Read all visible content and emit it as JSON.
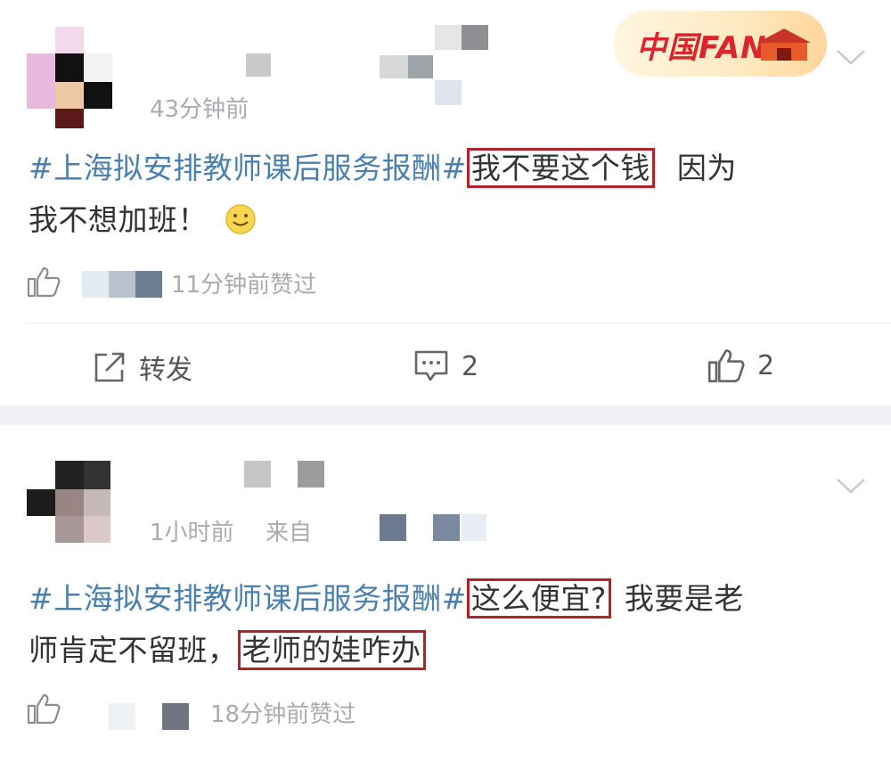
{
  "comments": [
    {
      "time": "43分钟前",
      "badge_text": "中国FANS",
      "topic": "#上海拟安排教师课后服务报酬#",
      "highlight_1": "我不要这个钱",
      "rest_line1": "因为",
      "line2": "我不想加班！",
      "emoji": "smile-emoji",
      "liked_text": "11分钟前赞过",
      "actions": {
        "repost": "转发",
        "comments": "2",
        "likes": "2"
      }
    },
    {
      "time": "1小时前",
      "from_label": "来自",
      "topic": "#上海拟安排教师课后服务报酬#",
      "highlight_1": "这么便宜?",
      "rest_line1": "我要是老",
      "line2_prefix": "师肯定不留班，",
      "highlight_2": "老师的娃咋办",
      "liked_text": "18分钟前赞过"
    }
  ],
  "colors": {
    "topic": "#4a7fae",
    "highlight_border": "#b5232a",
    "muted": "#a8abb0",
    "divider": "#eef0f3"
  }
}
